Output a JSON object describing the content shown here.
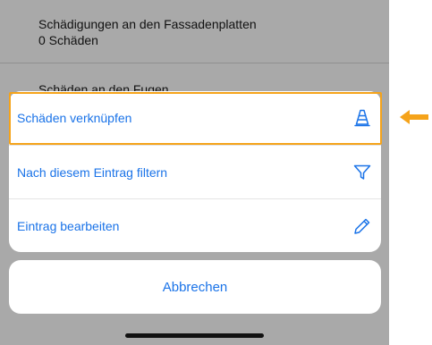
{
  "background_list": {
    "item1": {
      "title": "Schädigungen an den Fassadenplatten",
      "subtitle": "0 Schäden"
    },
    "item2": {
      "title": "Schäden an den Fugen"
    }
  },
  "action_sheet": {
    "actions": [
      {
        "label": "Schäden verknüpfen",
        "icon": "traffic-cone-icon",
        "highlighted": true
      },
      {
        "label": "Nach diesem Eintrag filtern",
        "icon": "filter-icon"
      },
      {
        "label": "Eintrag bearbeiten",
        "icon": "pencil-icon"
      }
    ],
    "cancel_label": "Abbrechen"
  },
  "annotation": {
    "arrow_icon": "arrow-left-icon",
    "color": "#f5a31a"
  },
  "colors": {
    "accent": "#1a73e8",
    "highlight": "#f5a31a",
    "overlay": "#a9a9a9"
  }
}
